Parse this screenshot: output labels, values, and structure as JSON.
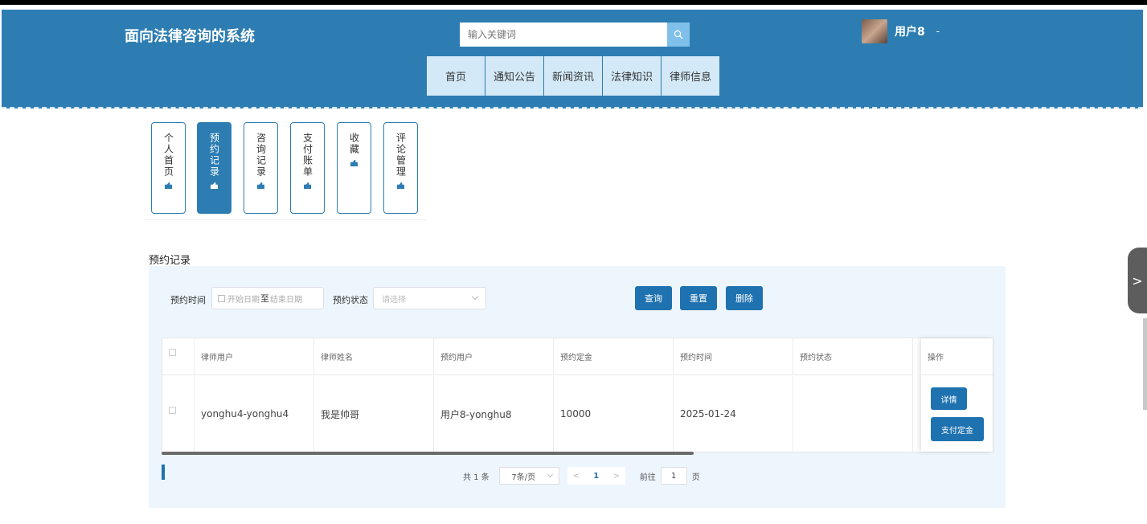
{
  "site": {
    "title": "面向法律咨询的系统"
  },
  "search": {
    "placeholder": "输入关键词"
  },
  "user": {
    "name": "用户8",
    "caret": "-"
  },
  "nav": {
    "items": [
      "首页",
      "通知公告",
      "新闻资讯",
      "法律知识",
      "律师信息"
    ]
  },
  "tabs": [
    {
      "label": "个人首页",
      "active": false
    },
    {
      "label": "预约记录",
      "active": true
    },
    {
      "label": "咨询记录",
      "active": false
    },
    {
      "label": "支付账单",
      "active": false
    },
    {
      "label": "收藏",
      "active": false
    },
    {
      "label": "评论管理",
      "active": false
    }
  ],
  "section": {
    "title": "预约记录"
  },
  "filters": {
    "time_label": "预约时间",
    "start_placeholder": "开始日期",
    "separator": "至",
    "end_placeholder": "结束日期",
    "status_label": "预约状态",
    "status_placeholder": "请选择"
  },
  "buttons": {
    "query": "查询",
    "reset": "重置",
    "delete": "删除"
  },
  "table": {
    "headers": [
      "律师用户",
      "律师姓名",
      "预约用户",
      "预约定金",
      "预约时间",
      "预约状态"
    ],
    "rows": [
      {
        "lawyer_user": "yonghu4-yonghu4",
        "lawyer_name": "我是帅哥",
        "booking_user": "用户8-yonghu8",
        "deposit": "10000",
        "time": "2025-01-24",
        "status": ""
      }
    ],
    "op_header": "操作",
    "op_buttons": {
      "detail": "详情",
      "pay": "支付定金"
    }
  },
  "pagination": {
    "total": "共 1 条",
    "page_size": "7条/页",
    "prev": "<",
    "current": "1",
    "next": ">",
    "goto_label": "前往",
    "goto_value": "1",
    "page_suffix": "页"
  },
  "side_handle": {
    "glyph": ">"
  }
}
